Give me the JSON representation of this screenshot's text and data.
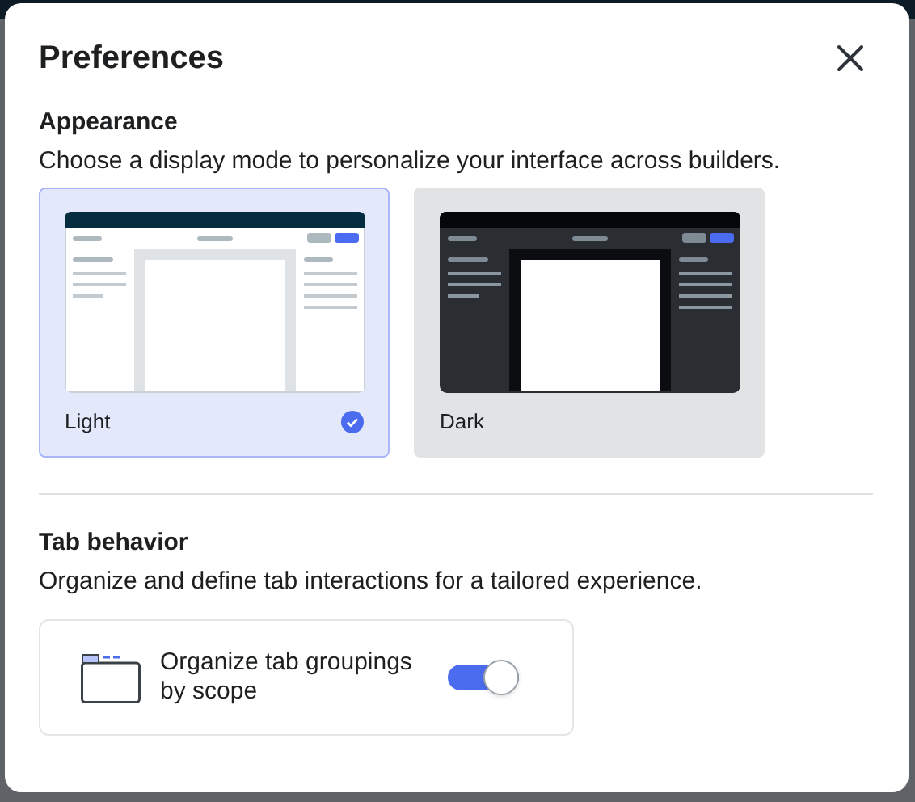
{
  "dialog": {
    "title": "Preferences"
  },
  "appearance": {
    "heading": "Appearance",
    "description": "Choose a display mode to personalize your interface across builders.",
    "modes": [
      {
        "label": "Light",
        "kind": "light",
        "selected": true
      },
      {
        "label": "Dark",
        "kind": "dark",
        "selected": false
      }
    ]
  },
  "tab_behavior": {
    "heading": "Tab behavior",
    "description": "Organize and define tab interactions for a tailored experience.",
    "option": {
      "label": "Organize tab groupings by scope",
      "on": true
    }
  }
}
